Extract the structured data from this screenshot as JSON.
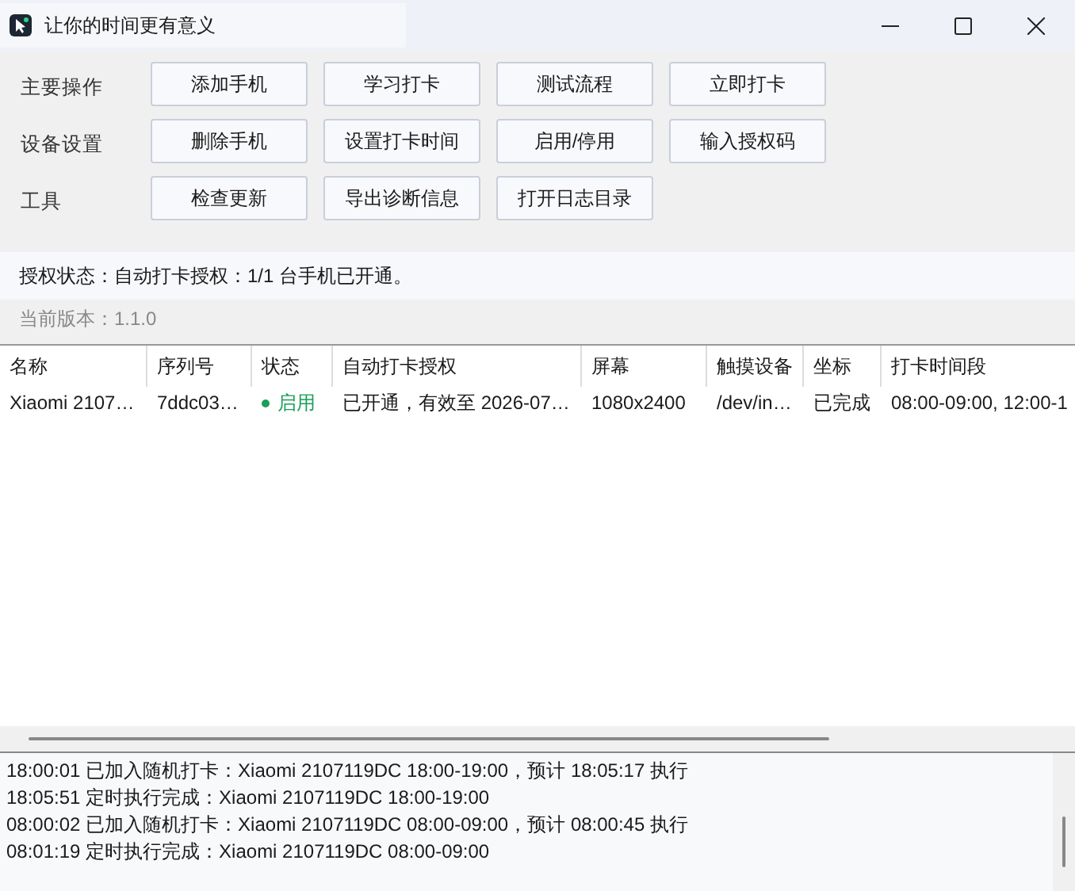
{
  "window": {
    "title": "让你的时间更有意义"
  },
  "toolbar_rows": [
    {
      "label": "主要操作",
      "buttons": [
        "添加手机",
        "学习打卡",
        "测试流程",
        "立即打卡"
      ]
    },
    {
      "label": "设备设置",
      "buttons": [
        "删除手机",
        "设置打卡时间",
        "启用/停用",
        "输入授权码"
      ]
    },
    {
      "label": "工具",
      "buttons": [
        "检查更新",
        "导出诊断信息",
        "打开日志目录"
      ]
    }
  ],
  "auth_status": "授权状态：自动打卡授权：1/1 台手机已开通。",
  "version": "当前版本：1.1.0",
  "table": {
    "columns": [
      "名称",
      "序列号",
      "状态",
      "自动打卡授权",
      "屏幕",
      "触摸设备",
      "坐标",
      "打卡时间段"
    ],
    "rows": [
      {
        "cells": [
          "Xiaomi 2107…",
          "7ddc03…",
          "启用",
          "已开通，有效至 2026-07…",
          "1080x2400",
          "/dev/in…",
          "已完成",
          "08:00-09:00, 12:00-1"
        ],
        "on": true
      }
    ]
  },
  "log": [
    "18:00:01 已加入随机打卡：Xiaomi 2107119DC 18:00-19:00，预计 18:05:17 执行",
    "18:05:51 定时执行完成：Xiaomi 2107119DC 18:00-19:00",
    "08:00:02 已加入随机打卡：Xiaomi 2107119DC 08:00-09:00，预计 08:00:45 执行",
    "08:01:19 定时执行完成：Xiaomi 2107119DC 08:00-09:00"
  ]
}
